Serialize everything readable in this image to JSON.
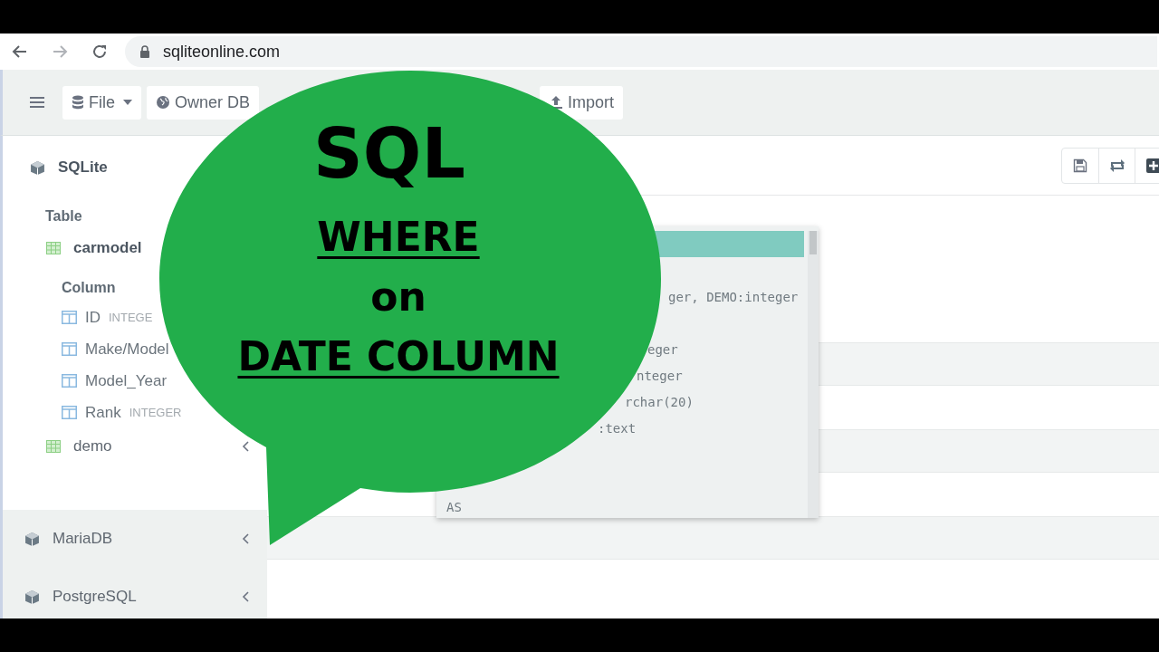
{
  "browser": {
    "url": "sqliteonline.com"
  },
  "toolbar": {
    "buttons": [
      {
        "kind": "file",
        "label": "File"
      },
      {
        "kind": "globe",
        "label": "Owner DB"
      },
      {
        "kind": "import",
        "label": "Import"
      }
    ]
  },
  "sidebar": {
    "sections": [
      {
        "name": "SQLite",
        "expanded": true,
        "tables_heading": "Table",
        "tables": [
          {
            "name": "carmodel",
            "expanded": true,
            "columns_heading": "Column",
            "columns": [
              {
                "name": "ID",
                "type": "INTEGE"
              },
              {
                "name": "Make/Model"
              },
              {
                "name": "Model_Year"
              },
              {
                "name": "Rank",
                "type": "INTEGER"
              }
            ]
          },
          {
            "name": "demo",
            "expanded": false
          }
        ]
      },
      {
        "name": "MariaDB",
        "expanded": false
      },
      {
        "name": "PostgreSQL",
        "expanded": false
      }
    ]
  },
  "autocomplete": {
    "items": [
      {
        "selected": true
      },
      {
        "text": "ger, DEMO:integer",
        "selected": false
      },
      {
        "text": "eger",
        "selected": false
      },
      {
        "text": "nteger",
        "selected": false
      },
      {
        "text": "rchar(20)",
        "selected": false
      },
      {
        "text": ":text",
        "selected": false
      },
      {
        "text": "AS",
        "selected": false
      }
    ]
  },
  "overlay": {
    "title": "SQL",
    "lines": [
      {
        "text": "WHERE",
        "underlined": true
      },
      {
        "text": "on",
        "underlined": false
      },
      {
        "text": "DATE COLUMN",
        "underlined": true
      }
    ]
  }
}
